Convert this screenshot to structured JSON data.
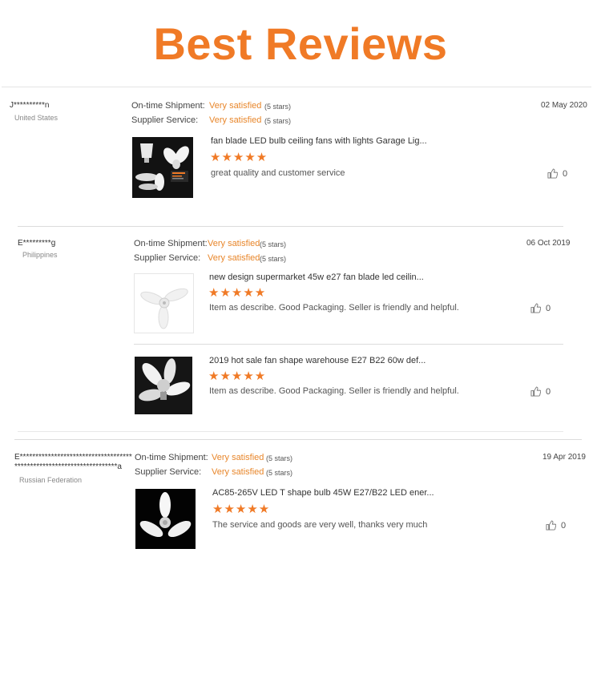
{
  "page": {
    "title": "Best Reviews"
  },
  "labels": {
    "shipment": "On-time Shipment:",
    "service": "Supplier Service:"
  },
  "icons": {
    "like": "thumbs-up-icon",
    "star": "star-icon"
  },
  "colors": {
    "accent": "#f07a26",
    "satisfied": "#e8862a"
  },
  "reviews": [
    {
      "user": "J**********n",
      "country": "United States",
      "shipment": "Very satisfied",
      "shipment_stars": "(5 stars)",
      "service": "Very satisfied",
      "service_stars": "(5 stars)",
      "date": "02 May 2020",
      "items": [
        {
          "title": "fan blade LED bulb ceiling fans with lights Garage Lig...",
          "rating": 5,
          "stars": "★★★★★",
          "comment": "great quality and customer service",
          "likes": "0"
        }
      ]
    },
    {
      "user": "E*********g",
      "country": "Philippines",
      "shipment": "Very satisfied",
      "shipment_stars": "(5 stars)",
      "service": "Very satisfied",
      "service_stars": "(5 stars)",
      "date": "06 Oct 2019",
      "items": [
        {
          "title": "new design supermarket 45w e27 fan blade led ceilin...",
          "rating": 5,
          "stars": "★★★★★",
          "comment": "Item as describe. Good Packaging. Seller is friendly and helpful.",
          "likes": "0"
        },
        {
          "title": "2019 hot sale fan shape warehouse E27 B22 60w def...",
          "rating": 5,
          "stars": "★★★★★",
          "comment": "Item as describe. Good Packaging. Seller is friendly and helpful.",
          "likes": "0"
        }
      ]
    },
    {
      "user": "E*********************************************************************a",
      "country": "Russian Federation",
      "shipment": "Very satisfied",
      "shipment_stars": "(5 stars)",
      "service": "Very satisfied",
      "service_stars": "(5 stars)",
      "date": "19 Apr 2019",
      "items": [
        {
          "title": "AC85-265V LED T shape bulb 45W E27/B22 LED ener...",
          "rating": 5,
          "stars": "★★★★★",
          "comment": "The service and goods are very well, thanks very much",
          "likes": "0"
        }
      ]
    }
  ]
}
